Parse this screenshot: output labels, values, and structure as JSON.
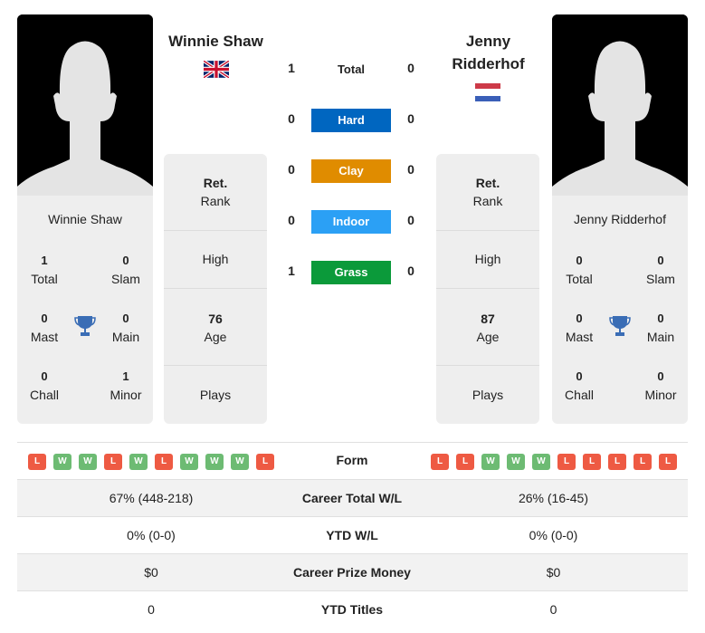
{
  "player1": {
    "name": "Winnie Shaw",
    "header_name": "Winnie Shaw",
    "flag": "gb-flag-icon",
    "titles": {
      "total": {
        "value": "1",
        "label": "Total"
      },
      "slam": {
        "value": "0",
        "label": "Slam"
      },
      "mast": {
        "value": "0",
        "label": "Mast"
      },
      "main": {
        "value": "0",
        "label": "Main"
      },
      "chall": {
        "value": "0",
        "label": "Chall"
      },
      "minor": {
        "value": "1",
        "label": "Minor"
      }
    },
    "info": {
      "rank_value": "Ret.",
      "rank_label": "Rank",
      "high_label": "High",
      "age_value": "76",
      "age_label": "Age",
      "plays_label": "Plays"
    },
    "form": [
      "L",
      "W",
      "W",
      "L",
      "W",
      "L",
      "W",
      "W",
      "W",
      "L"
    ]
  },
  "player2": {
    "name": "Jenny Ridderhof",
    "header_name_line1": "Jenny",
    "header_name_line2": "Ridderhof",
    "flag": "nl-flag-icon",
    "titles": {
      "total": {
        "value": "0",
        "label": "Total"
      },
      "slam": {
        "value": "0",
        "label": "Slam"
      },
      "mast": {
        "value": "0",
        "label": "Mast"
      },
      "main": {
        "value": "0",
        "label": "Main"
      },
      "chall": {
        "value": "0",
        "label": "Chall"
      },
      "minor": {
        "value": "0",
        "label": "Minor"
      }
    },
    "info": {
      "rank_value": "Ret.",
      "rank_label": "Rank",
      "high_label": "High",
      "age_value": "87",
      "age_label": "Age",
      "plays_label": "Plays"
    },
    "form": [
      "L",
      "L",
      "W",
      "W",
      "W",
      "L",
      "L",
      "L",
      "L",
      "L"
    ]
  },
  "h2h": {
    "rows": [
      {
        "label": "Total",
        "p1": "1",
        "p2": "0",
        "color": null
      },
      {
        "label": "Hard",
        "p1": "0",
        "p2": "0",
        "color": "#0066c0"
      },
      {
        "label": "Clay",
        "p1": "0",
        "p2": "0",
        "color": "#e08c00"
      },
      {
        "label": "Indoor",
        "p1": "0",
        "p2": "0",
        "color": "#2ba0f5"
      },
      {
        "label": "Grass",
        "p1": "1",
        "p2": "0",
        "color": "#0b9a3a"
      }
    ]
  },
  "form_label": "Form",
  "stats": [
    {
      "label": "Career Total W/L",
      "p1": "67% (448-218)",
      "p2": "26% (16-45)"
    },
    {
      "label": "YTD W/L",
      "p1": "0% (0-0)",
      "p2": "0% (0-0)"
    },
    {
      "label": "Career Prize Money",
      "p1": "$0",
      "p2": "$0"
    },
    {
      "label": "YTD Titles",
      "p1": "0",
      "p2": "0"
    }
  ],
  "colors": {
    "win": "#6dbb73",
    "loss": "#ee5a43",
    "trophy": "#3a6db5"
  }
}
